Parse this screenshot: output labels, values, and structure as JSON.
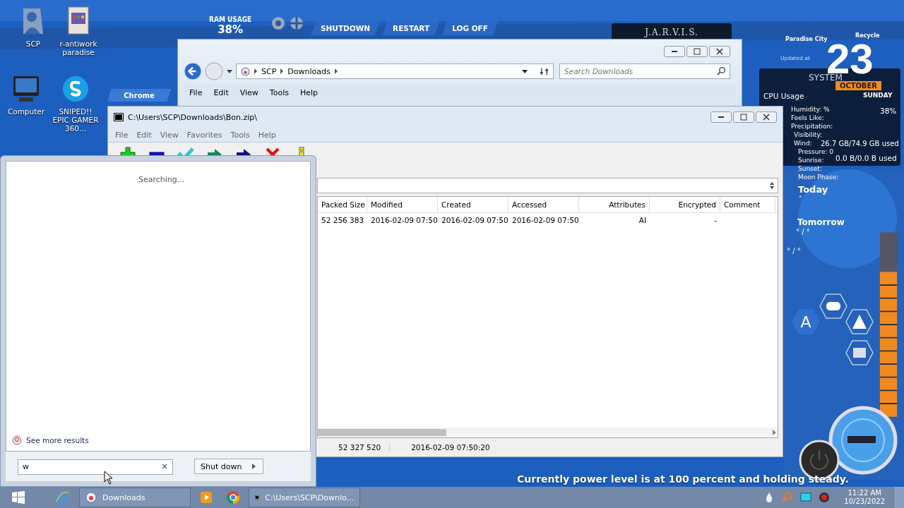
{
  "desktop_icons": [
    {
      "label": "SCP",
      "kind": "user"
    },
    {
      "label": "r-antiwork paradise",
      "kind": "file"
    },
    {
      "label": "Computer",
      "kind": "computer"
    },
    {
      "label": "SNIPED!! EPIC GAMER 360...",
      "kind": "skype"
    }
  ],
  "hud": {
    "ram_label": "RAM USAGE",
    "ram_value": "38%",
    "buttons": [
      "SHUTDOWN",
      "RESTART",
      "LOG OFF"
    ],
    "shortcut": "Chrome",
    "assistant": "J.A.R.V.I.S.",
    "city": "Paradise City",
    "recycle": "Recycle",
    "updated": "Updated at",
    "day": "23",
    "month": "OCTOBER",
    "weekday": "SUNDAY",
    "system": "SYSTEM",
    "cpu_label": "CPU Usage",
    "cpu_value": "38%",
    "disk_used": "26.7 GB/74.9 GB used",
    "disk2_used": "0.0 B/0.0 B used",
    "weather": [
      "Humidity: %",
      "Feels Like:",
      "Precipitation:",
      "Visibility:",
      "Wind:",
      "Pressure:  0",
      "Sunrise:",
      "Sunset:",
      "Moon Phase:"
    ],
    "today": "Today",
    "today_temp": "°",
    "tomorrow": "Tomorrow",
    "tomorrow_temp": "° / °",
    "later_temp": "° / °",
    "hex_letter": "A",
    "status": "Currently power level is at 100 percent and holding steady."
  },
  "explorer": {
    "path": [
      "SCP",
      "Downloads"
    ],
    "search_placeholder": "Search Downloads",
    "menu": [
      "File",
      "Edit",
      "View",
      "Tools",
      "Help"
    ]
  },
  "archive": {
    "title": "C:\\Users\\SCP\\Downloads\\Bon.zip\\",
    "menu": [
      "File",
      "Edit",
      "View",
      "Favorites",
      "Tools",
      "Help"
    ],
    "columns": [
      "Packed Size",
      "Modified",
      "Created",
      "Accessed",
      "Attributes",
      "Encrypted",
      "Comment"
    ],
    "rows": [
      [
        "52 256 383",
        "2016-02-09 07:50",
        "2016-02-09 07:50",
        "2016-02-09 07:50",
        "AI",
        "-"
      ]
    ],
    "status": [
      "52 327 520",
      "2016-02-09 07:50:20"
    ]
  },
  "start_menu": {
    "searching": "Searching...",
    "more": "See more results",
    "search_value": "w",
    "shutdown": "Shut down"
  },
  "taskbar": {
    "windows": [
      {
        "label": "Downloads",
        "kind": "explorer",
        "selected": false
      },
      {
        "label": "C:\\Users\\SCP\\Downlo...",
        "kind": "archive",
        "selected": false
      }
    ],
    "time": "11:22 AM",
    "date": "10/23/2022"
  }
}
